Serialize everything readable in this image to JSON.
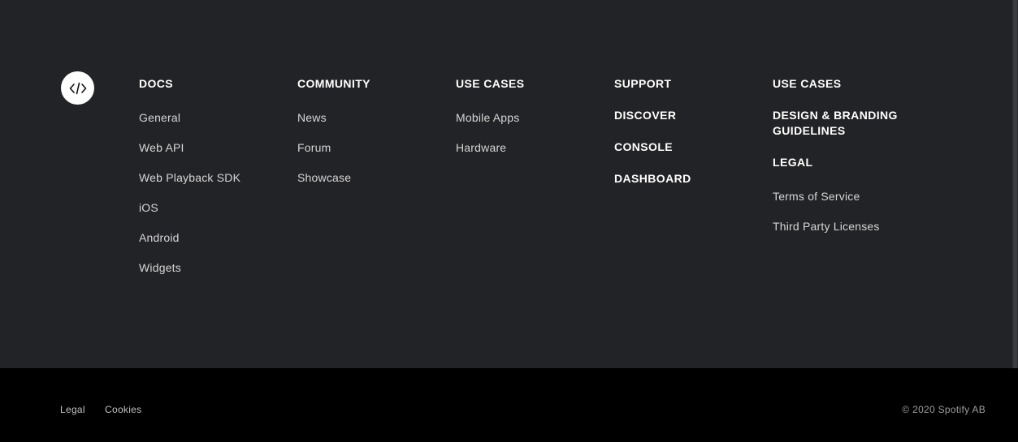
{
  "footer": {
    "logo_icon": "code-icon",
    "columns": [
      {
        "headings": [
          "DOCS"
        ],
        "links": [
          "General",
          "Web API",
          "Web Playback SDK",
          "iOS",
          "Android",
          "Widgets"
        ]
      },
      {
        "headings": [
          "COMMUNITY"
        ],
        "links": [
          "News",
          "Forum",
          "Showcase"
        ]
      },
      {
        "headings": [
          "USE CASES"
        ],
        "links": [
          "Mobile Apps",
          "Hardware"
        ]
      },
      {
        "headings": [
          "SUPPORT",
          "DISCOVER",
          "CONSOLE",
          "DASHBOARD"
        ],
        "links": []
      },
      {
        "headings": [
          "USE CASES",
          "DESIGN & BRANDING GUIDELINES",
          "LEGAL"
        ],
        "links": [
          "Terms of Service",
          "Third Party Licenses"
        ]
      }
    ],
    "bottom": {
      "legal": "Legal",
      "cookies": "Cookies",
      "copyright": "© 2020 Spotify AB"
    },
    "colors": {
      "background_top": "#222326",
      "background_bottom": "#000000",
      "heading": "#ffffff",
      "link": "#d6d6d6"
    }
  }
}
